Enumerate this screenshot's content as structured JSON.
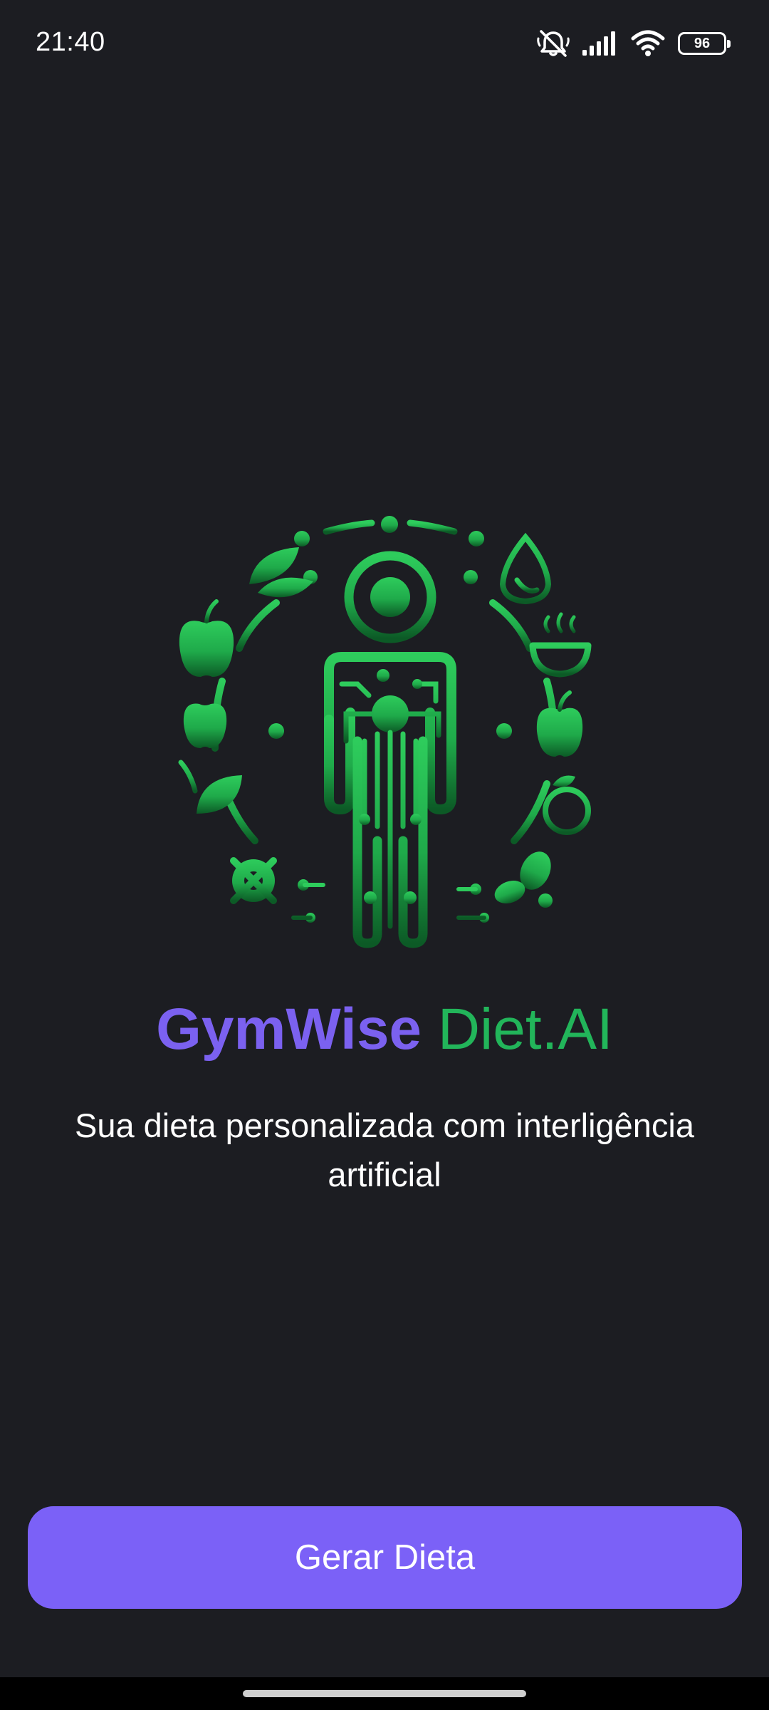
{
  "status_bar": {
    "time": "21:40",
    "battery_level": "96",
    "icons": [
      "mute-icon",
      "signal-icon",
      "wifi-icon",
      "battery-icon"
    ]
  },
  "hero": {
    "icon": "human-nutrition-ai-illustration"
  },
  "title": {
    "brand": "GymWise",
    "suffix": "Diet.AI"
  },
  "subtitle": "Sua dieta personalizada com interligência artificial",
  "cta": {
    "label": "Gerar Dieta"
  },
  "colors": {
    "background": "#1c1d22",
    "brand_purple": "#7b61f0",
    "brand_green": "#22b55a",
    "button": "#7b61f7"
  }
}
